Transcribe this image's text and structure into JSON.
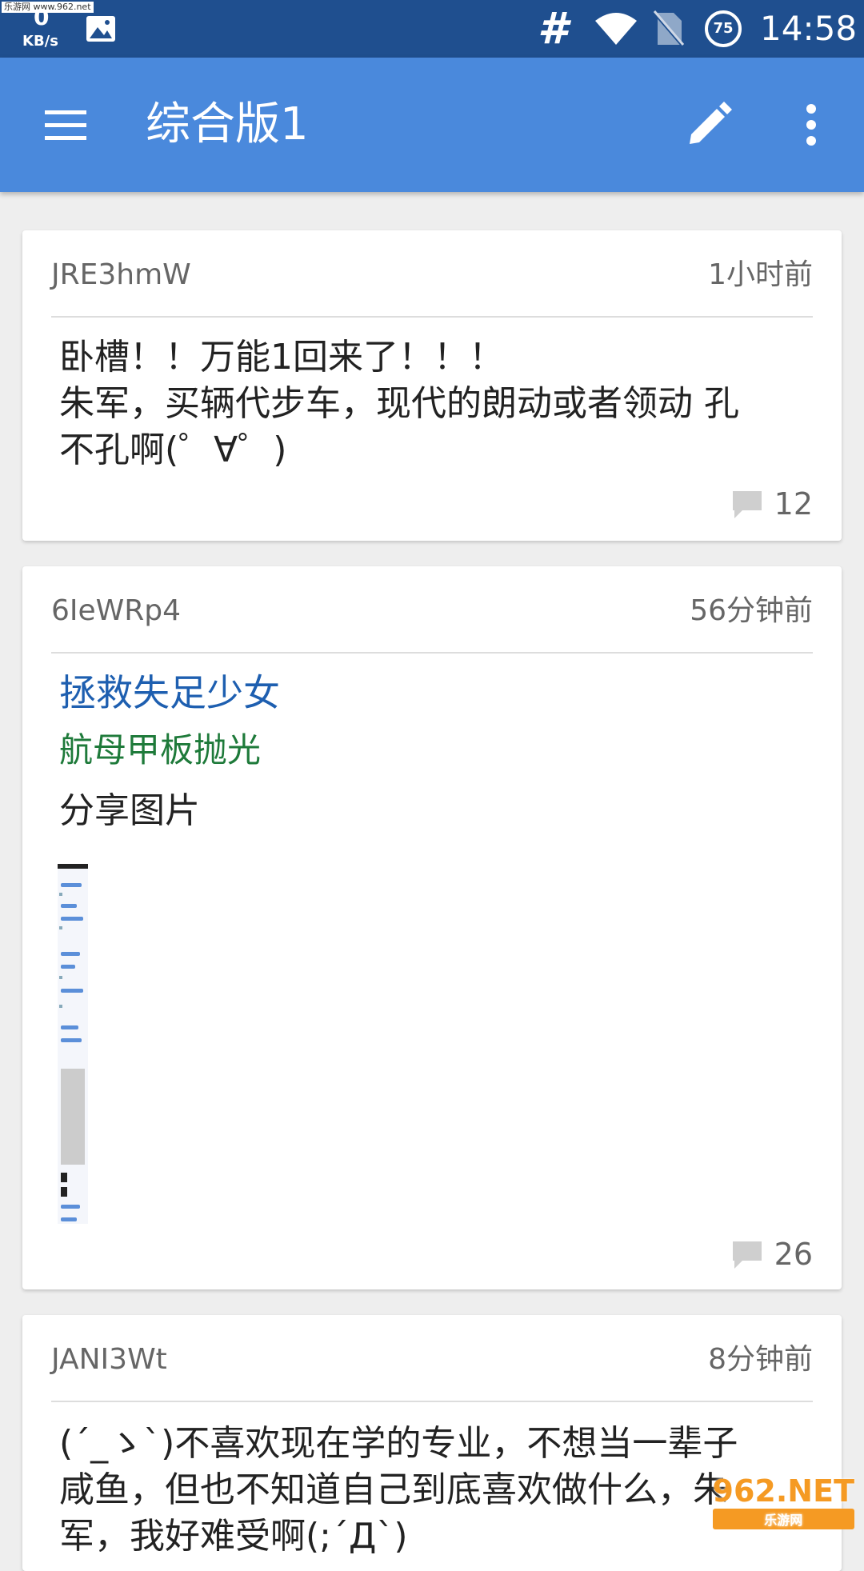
{
  "status_bar": {
    "watermark": "乐游网 www.962.net",
    "net_speed": "0",
    "net_unit": "KB/s",
    "signal_symbol": "#",
    "battery": "75",
    "time": "14:58"
  },
  "app_bar": {
    "title": "综合版1"
  },
  "posts": [
    {
      "author": "JRE3hmW",
      "time": "1小时前",
      "lines": [
        "卧槽！！万能1回来了！！！",
        "朱军，买辆代步车，现代的朗动或者领动 孔",
        "不孔啊(゜∀゜)"
      ],
      "comments": "12"
    },
    {
      "author": "6IeWRp4",
      "time": "56分钟前",
      "link_title": "拯救失足少女",
      "link_subtitle": "航母甲板抛光",
      "share_text": "分享图片",
      "comments": "26"
    },
    {
      "author": "JANI3Wt",
      "time": "8分钟前",
      "lines": [
        "(´_ゝ`)不喜欢现在学的专业，不想当一辈子",
        "咸鱼，但也不知道自己到底喜欢做什么，朱",
        "军，我好难受啊(;´Д`)"
      ]
    }
  ],
  "corner_watermark": {
    "text": "962.NET",
    "sub": "乐游网"
  }
}
